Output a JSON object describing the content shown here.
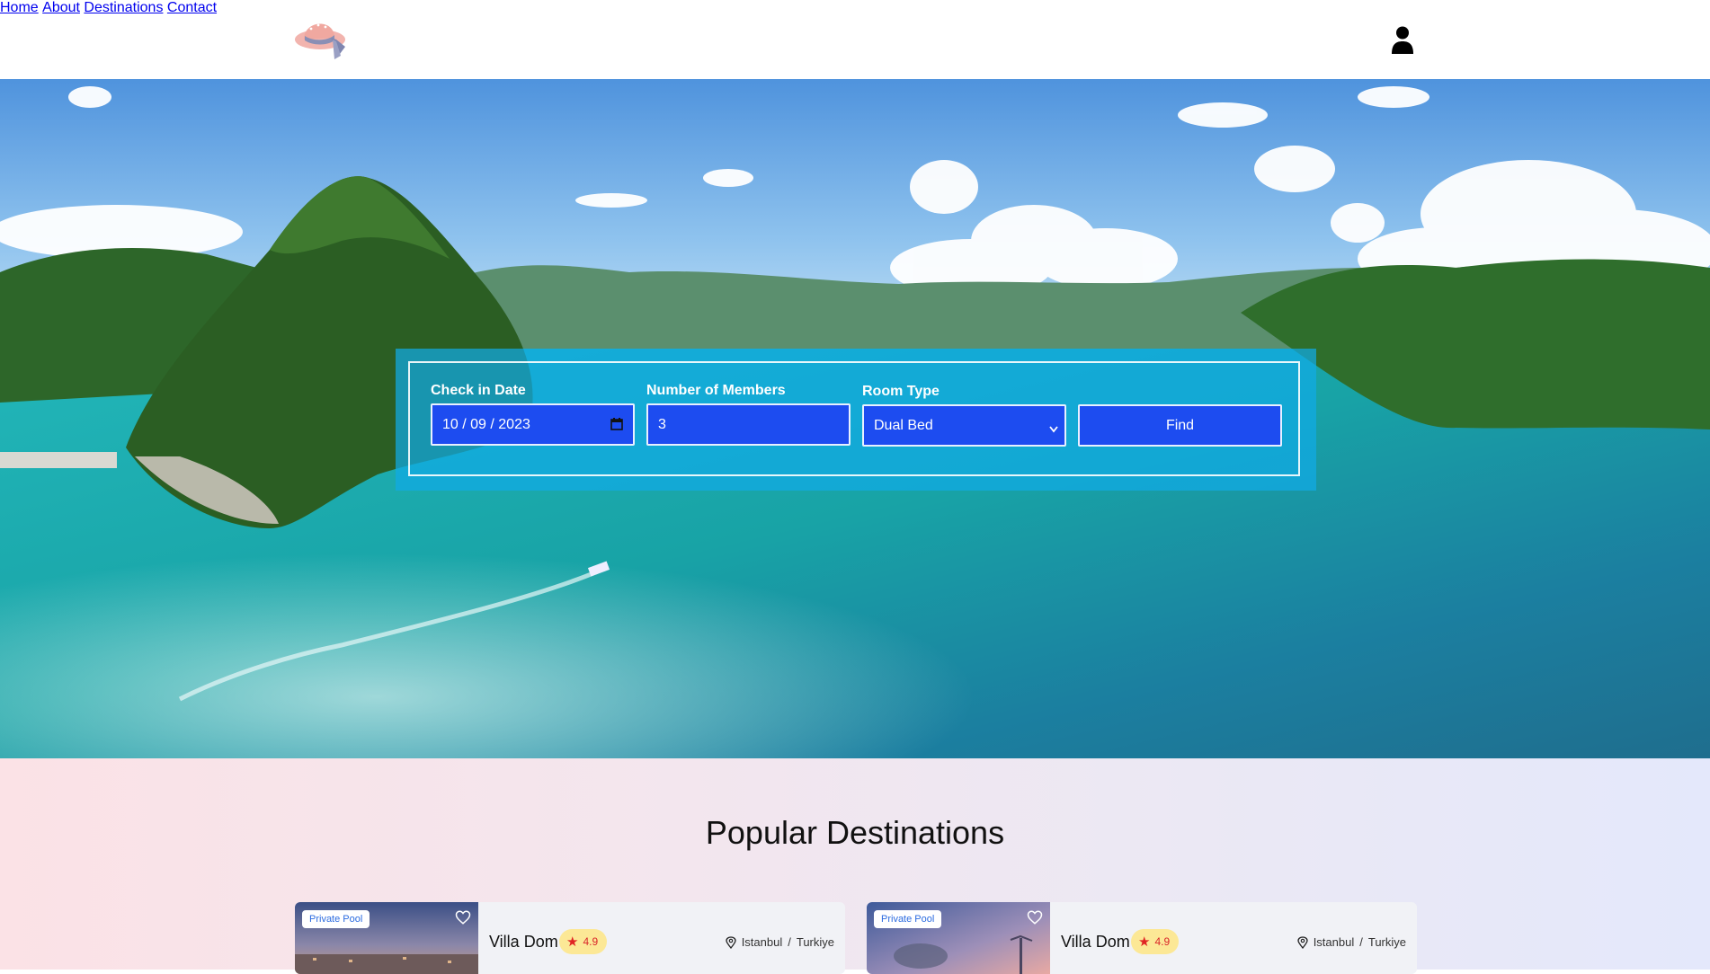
{
  "nav": {
    "links": [
      "Home",
      "About",
      "Destinations",
      "Contact"
    ]
  },
  "icons": {
    "logo": "pink-hat-logo",
    "user": "user-icon",
    "calendar": "calendar-icon",
    "dropdown": "chevron-down-icon",
    "heart": "heart-icon",
    "star": "star-icon",
    "location": "map-pin-icon"
  },
  "search": {
    "checkin_label": "Check in Date",
    "checkin_value": "10 / 09 / 2023",
    "members_label": "Number of Members",
    "members_value": "3",
    "room_label": "Room Type",
    "room_value": "Dual Bed",
    "find_label": "Find"
  },
  "popular": {
    "title": "Popular Destinations",
    "cards": [
      {
        "badge": "Private Pool",
        "name": "Villa Dom",
        "rating": "4.9",
        "city": "Istanbul",
        "separator": "/",
        "country": "Turkiye"
      },
      {
        "badge": "Private Pool",
        "name": "Villa Dom",
        "rating": "4.9",
        "city": "Istanbul",
        "separator": "/",
        "country": "Turkiye"
      }
    ]
  },
  "colors": {
    "accent_blue": "#1d4cf0",
    "panel": "#10aae6",
    "rating_bg": "#fce896",
    "star": "#e02424"
  }
}
